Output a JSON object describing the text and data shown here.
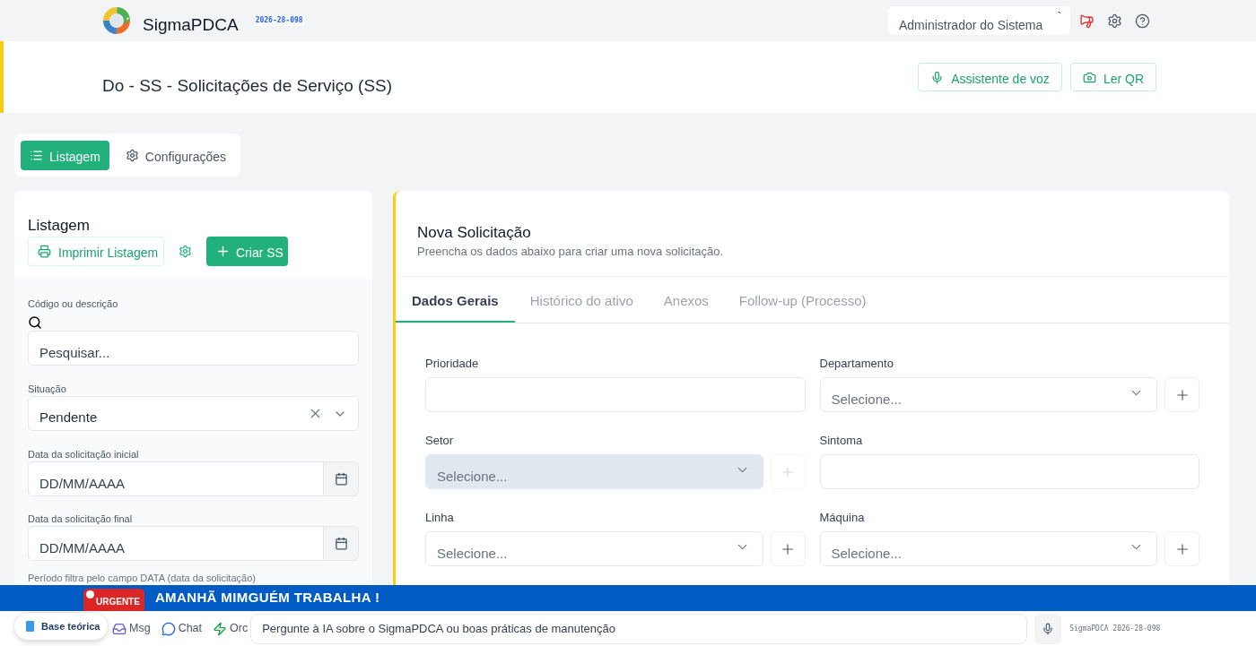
{
  "header": {
    "app_name": "SigmaPDCA",
    "version": "2026-28-098",
    "user": "Administrador do Sistema",
    "user_caret": "`"
  },
  "page": {
    "title": "Do - SS - Solicitações de Serviço (SS)",
    "actions": [
      {
        "label": "Assistente de voz"
      },
      {
        "label": "Ler QR"
      }
    ]
  },
  "view_tabs": [
    {
      "label": "Listagem",
      "selected": true
    },
    {
      "label": "Configurações",
      "selected": false
    }
  ],
  "listing": {
    "title": "Listagem",
    "print_button": "Imprimir Listagem",
    "create_button": "Criar SS",
    "filters": [
      {
        "kind": "search",
        "label": "Código ou descrição",
        "placeholder": "Pesquisar..."
      },
      {
        "kind": "select",
        "label": "Situação",
        "value": "Pendente"
      },
      {
        "kind": "date",
        "label": "Data da solicitação inicial",
        "placeholder": "DD/MM/AAAA"
      },
      {
        "kind": "date",
        "label": "Data da solicitação final",
        "placeholder": "DD/MM/AAAA"
      }
    ],
    "note": "Período filtra pelo campo DATA (data da solicitação)"
  },
  "form": {
    "title": "Nova Solicitação",
    "subtitle": "Preencha os dados abaixo para criar uma nova solicitação.",
    "tabs": [
      {
        "label": "Dados Gerais",
        "selected": true
      },
      {
        "label": "Histórico do ativo",
        "selected": false
      },
      {
        "label": "Anexos",
        "selected": false
      },
      {
        "label": "Follow-up (Processo)",
        "selected": false
      }
    ],
    "fields": [
      {
        "kind": "input",
        "label": "Prioridade",
        "disabled": false
      },
      {
        "kind": "select",
        "label": "Departamento",
        "placeholder": "Selecione...",
        "disabled": false
      },
      {
        "kind": "select",
        "label": "Setor",
        "placeholder": "Selecione...",
        "disabled": true
      },
      {
        "kind": "input",
        "label": "Sintoma",
        "disabled": false
      },
      {
        "kind": "select",
        "label": "Linha",
        "placeholder": "Selecione...",
        "disabled": false
      },
      {
        "kind": "select",
        "label": "Máquina",
        "placeholder": "Selecione...",
        "disabled": false
      }
    ]
  },
  "alert_banner": {
    "badge": "URGENTE",
    "message": "AMANHÃ MIMGUÉM TRABALHA !"
  },
  "help_pill": {
    "label": "Base teórica"
  },
  "bottom_bar": {
    "shortcuts": [
      {
        "label": "Msg"
      },
      {
        "label": "Chat"
      },
      {
        "label": "Orc"
      }
    ],
    "ask_placeholder": "Pergunte à IA sobre o SigmaPDCA ou boas práticas de manutenção",
    "footer_version": "SigmaPDCA 2026-28-098"
  }
}
